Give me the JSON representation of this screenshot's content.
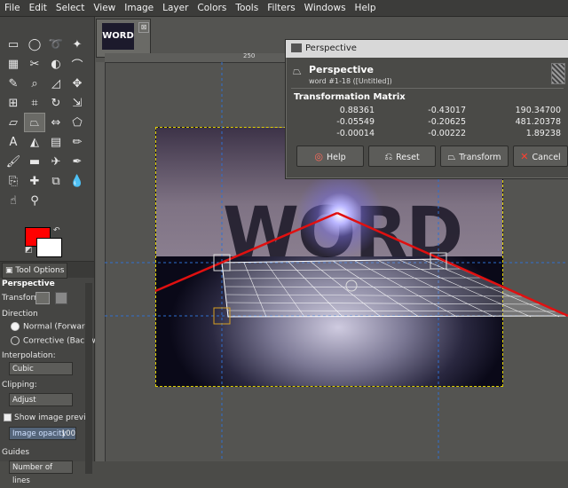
{
  "menubar": [
    "File",
    "Edit",
    "Select",
    "View",
    "Image",
    "Layer",
    "Colors",
    "Tools",
    "Filters",
    "Windows",
    "Help"
  ],
  "image_tab": {
    "thumb_text": "WORD",
    "close": "⊠"
  },
  "ruler": {
    "mark": "250"
  },
  "image": {
    "word": "WORD"
  },
  "tool_options": {
    "tab_label": "Tool Options",
    "tool_name": "Perspective",
    "transform_label": "Transform:",
    "direction_label": "Direction",
    "direction_normal": "Normal (Forward",
    "direction_corrective": "Corrective (Backw",
    "interpolation_label": "Interpolation:",
    "interpolation_value": "Cubic",
    "clipping_label": "Clipping:",
    "clipping_value": "Adjust",
    "show_preview": "Show image previe",
    "opacity_label": "Image opacity",
    "opacity_value": "100",
    "guides_label": "Guides",
    "guides_value": "Number of lines"
  },
  "dialog": {
    "window_title": "Perspective",
    "heading": "Perspective",
    "subheading": "word #1-18 ([Untitled])",
    "matrix_title": "Transformation Matrix",
    "matrix": [
      [
        "0.88361",
        "-0.43017",
        "190.34700"
      ],
      [
        "-0.05549",
        "-0.20625",
        "481.20378"
      ],
      [
        "-0.00014",
        "-0.00222",
        "1.89238"
      ]
    ],
    "buttons": {
      "help": "Help",
      "reset": "Reset",
      "transform": "Transform",
      "cancel": "Cancel"
    }
  },
  "colors": {
    "foreground": "#ff0000",
    "background": "#ffffff",
    "selection": "#e0d000",
    "guide": "#2f6fd0",
    "transform_line": "#e01010"
  }
}
